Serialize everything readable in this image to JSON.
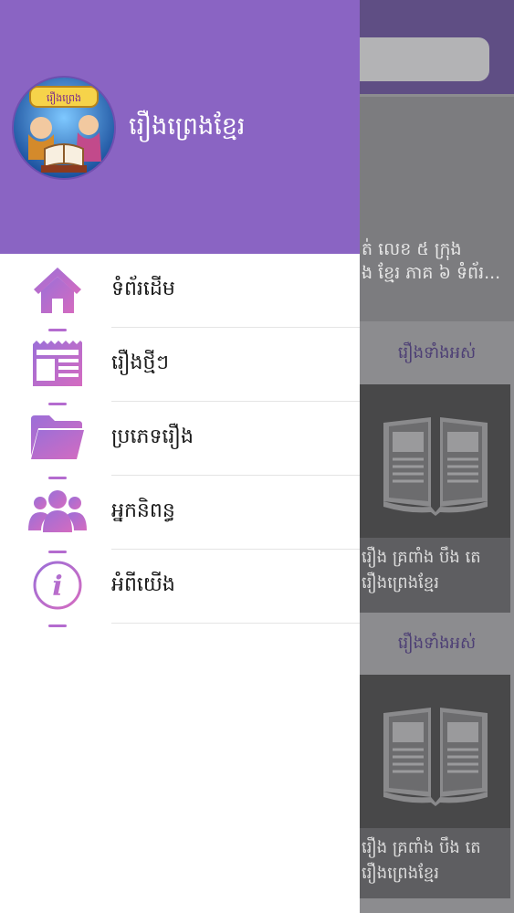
{
  "app": {
    "title": "រឿងព្រេងខ្មែរ",
    "logo_text": "រឿងព្រេង"
  },
  "menu": {
    "items": [
      {
        "label": "ទំព័រដើម",
        "icon": "home-icon"
      },
      {
        "label": "រឿងថ្មីៗ",
        "icon": "newspaper-icon"
      },
      {
        "label": "ប្រភេទរឿង",
        "icon": "folder-icon"
      },
      {
        "label": "អ្នកនិពន្ធ",
        "icon": "users-icon"
      },
      {
        "label": "អំពីយើង",
        "icon": "info-icon"
      }
    ]
  },
  "background": {
    "banner_text_line1": "ត់ លេខ ៥ ក្រុង",
    "banner_text_line2": "ង ខ្មែរ ភាគ ៦ ទំព័រ...",
    "sections": [
      {
        "label": "រឿងទាំងអស់",
        "card_line1": "រឿង គ្រពាំង បឹង តេ",
        "card_line2": "រឿងព្រេងខ្មែរ"
      },
      {
        "label": "រឿងទាំងអស់",
        "card_line1": "រឿង គ្រពាំង បឹង តេ",
        "card_line2": "រឿងព្រេងខ្មែរ"
      }
    ]
  },
  "colors": {
    "drawer_header": "#8a64c3",
    "icon_gradient_start": "#9b6fd8",
    "icon_gradient_end": "#d46bc0"
  }
}
